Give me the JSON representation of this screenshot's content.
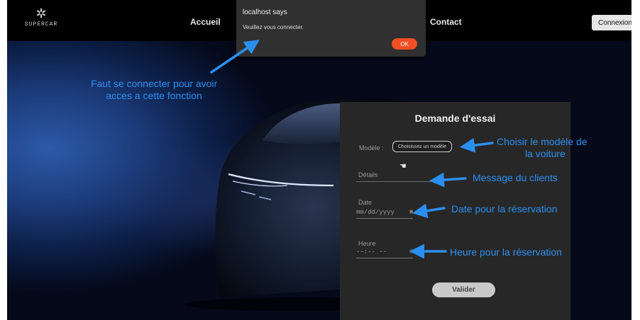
{
  "brand": {
    "name": "SUPERCAR",
    "logo_icon": "star-emblem-icon"
  },
  "nav": {
    "accueil": "Accueil",
    "contact": "Contact",
    "login": "Connexion"
  },
  "alert": {
    "title": "localhost says",
    "message": "Veuillez vous connecter.",
    "ok": "OK"
  },
  "annotations": {
    "top_line1": "Faut se connecter pour avoir",
    "top_line2": "acces a cette fonction",
    "modele_line1": "Choisir le modèle de",
    "modele_line2": "la voiture",
    "details": "Message du clients",
    "date": "Date pour la réservation",
    "heure": "Heure pour la réservation",
    "color": "#2b8ff0"
  },
  "form": {
    "title": "Demande d'essai",
    "modele_label": "Modèle :",
    "modele_select": "Choisissez un modèle",
    "details_placeholder": "Détails",
    "date_label": "Date",
    "date_placeholder": "mm/dd/yyyy",
    "heure_label": "Heure",
    "heure_placeholder": "--:-- --",
    "submit": "Valider"
  }
}
